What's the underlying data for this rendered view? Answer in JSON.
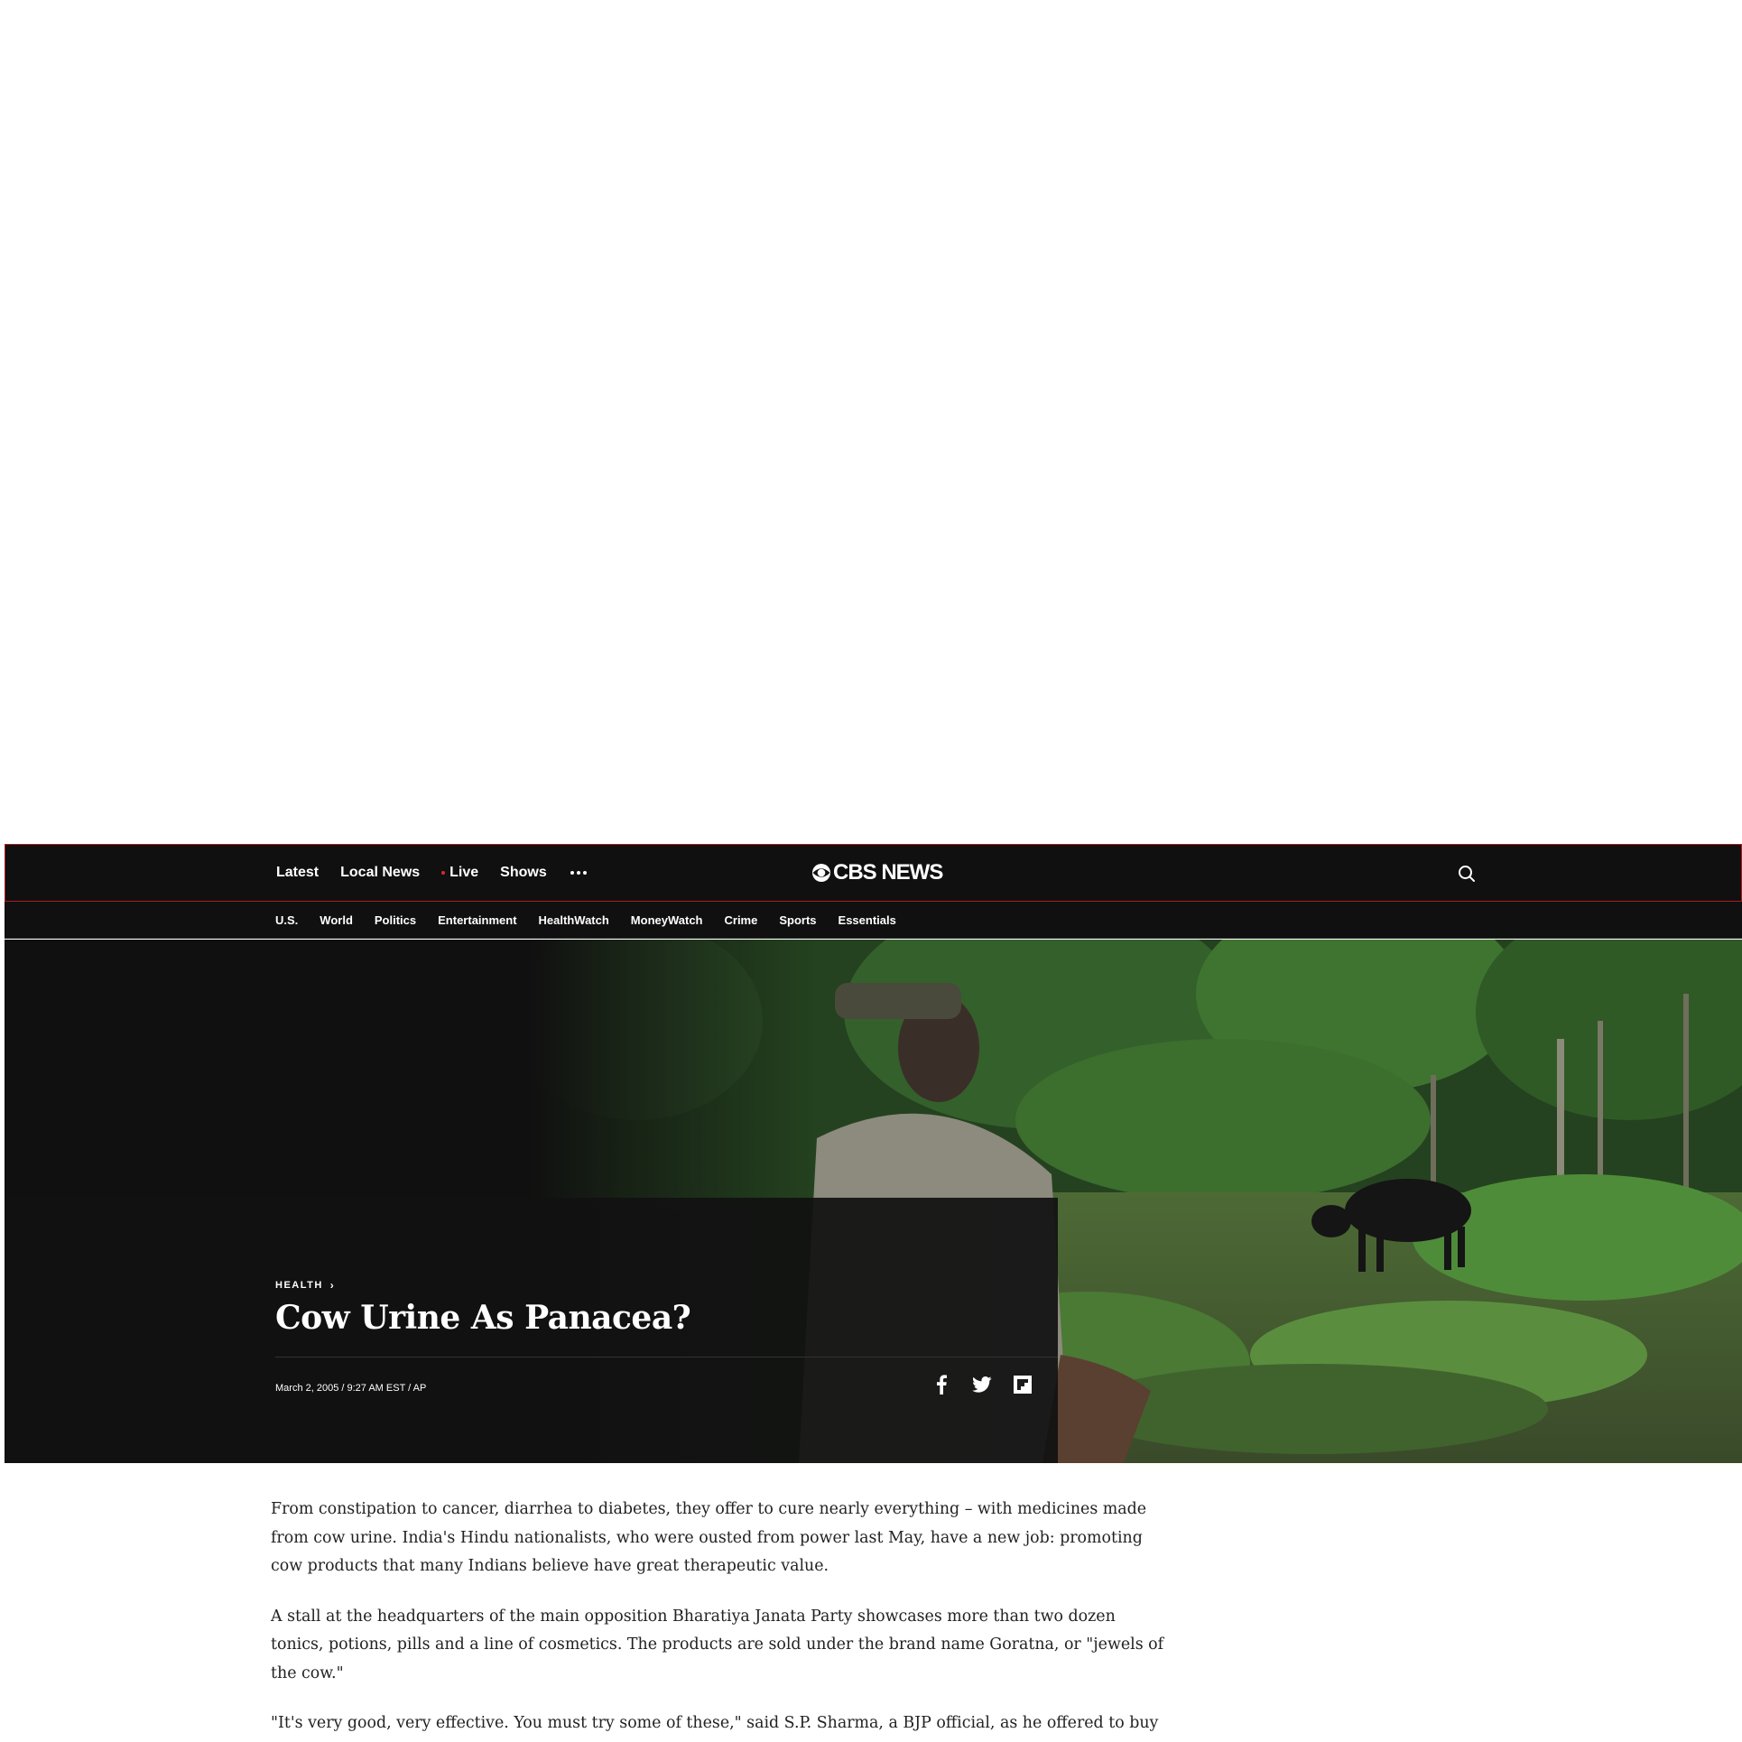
{
  "topnav": {
    "links": [
      "Latest",
      "Local News",
      "Live",
      "Shows"
    ],
    "more_icon": "more-dots-icon",
    "logo_text": "CBS NEWS",
    "logo_icon": "cbs-eye-icon",
    "search_icon": "search-icon"
  },
  "subnav": {
    "links": [
      "U.S.",
      "World",
      "Politics",
      "Entertainment",
      "HealthWatch",
      "MoneyWatch",
      "Crime",
      "Sports",
      "Essentials"
    ]
  },
  "hero": {
    "kicker": "HEALTH",
    "headline": "Cow Urine As Panacea?",
    "byline": "March 2, 2005 / 9:27 AM EST / AP",
    "share_icons": [
      "facebook-icon",
      "twitter-icon",
      "flipboard-icon"
    ]
  },
  "article": {
    "paragraphs": [
      "From constipation to cancer, diarrhea to diabetes, they offer to cure nearly everything – with medicines made from cow urine. India's Hindu nationalists, who were ousted from power last May, have a new job: promoting cow products that many Indians believe have great therapeutic value.",
      "A stall at the headquarters of the main opposition Bharatiya Janata Party showcases more than two dozen tonics, potions, pills and a line of cosmetics. The products are sold under the brand name Goratna, or \"jewels of the cow.\"",
      "\"It's very good, very effective. You must try some of these,\" said S.P. Sharma, a BJP official, as he offered to buy a pack of face cream he said helped his daughter get rid of pimples."
    ]
  },
  "colors": {
    "nav_bg": "#101010",
    "accent_red": "#e0262e",
    "nav_border": "#b01c1c",
    "body_text": "#222222"
  }
}
